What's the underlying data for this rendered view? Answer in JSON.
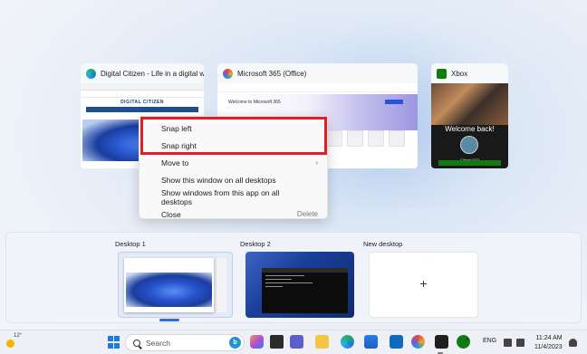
{
  "windows": [
    {
      "title": "Digital Citizen - Life in a digital w...",
      "logo_text": "DIGITAL CITIZEN",
      "icon": "edge-icon"
    },
    {
      "title": "Microsoft 365 (Office)",
      "welcome_text": "Welcome to Microsoft 365",
      "icon": "microsoft-365-icon"
    },
    {
      "title": "Xbox",
      "welcome_text": "Welcome back!",
      "gamertag": "Citizen1973",
      "icon": "xbox-icon"
    }
  ],
  "context_menu": {
    "items": [
      {
        "label": "Snap left",
        "shortcut": ""
      },
      {
        "label": "Snap right",
        "shortcut": ""
      },
      {
        "label": "Move to",
        "shortcut": "›"
      },
      {
        "label": "Show this window on all desktops",
        "shortcut": ""
      },
      {
        "label": "Show windows from this app on all desktops",
        "shortcut": ""
      },
      {
        "label": "Close",
        "shortcut": "Delete"
      }
    ]
  },
  "desktops": {
    "d1": "Desktop 1",
    "d2": "Desktop 2",
    "new": "New desktop",
    "plus": "+"
  },
  "taskbar": {
    "weather_temp": "12°",
    "search_placeholder": "Search",
    "bing_label": "b",
    "language": "ENG",
    "time": "11:24 AM",
    "date": "11/4/2023"
  },
  "colors": {
    "highlight": "#e21d24",
    "accent": "#2f6fd4"
  }
}
